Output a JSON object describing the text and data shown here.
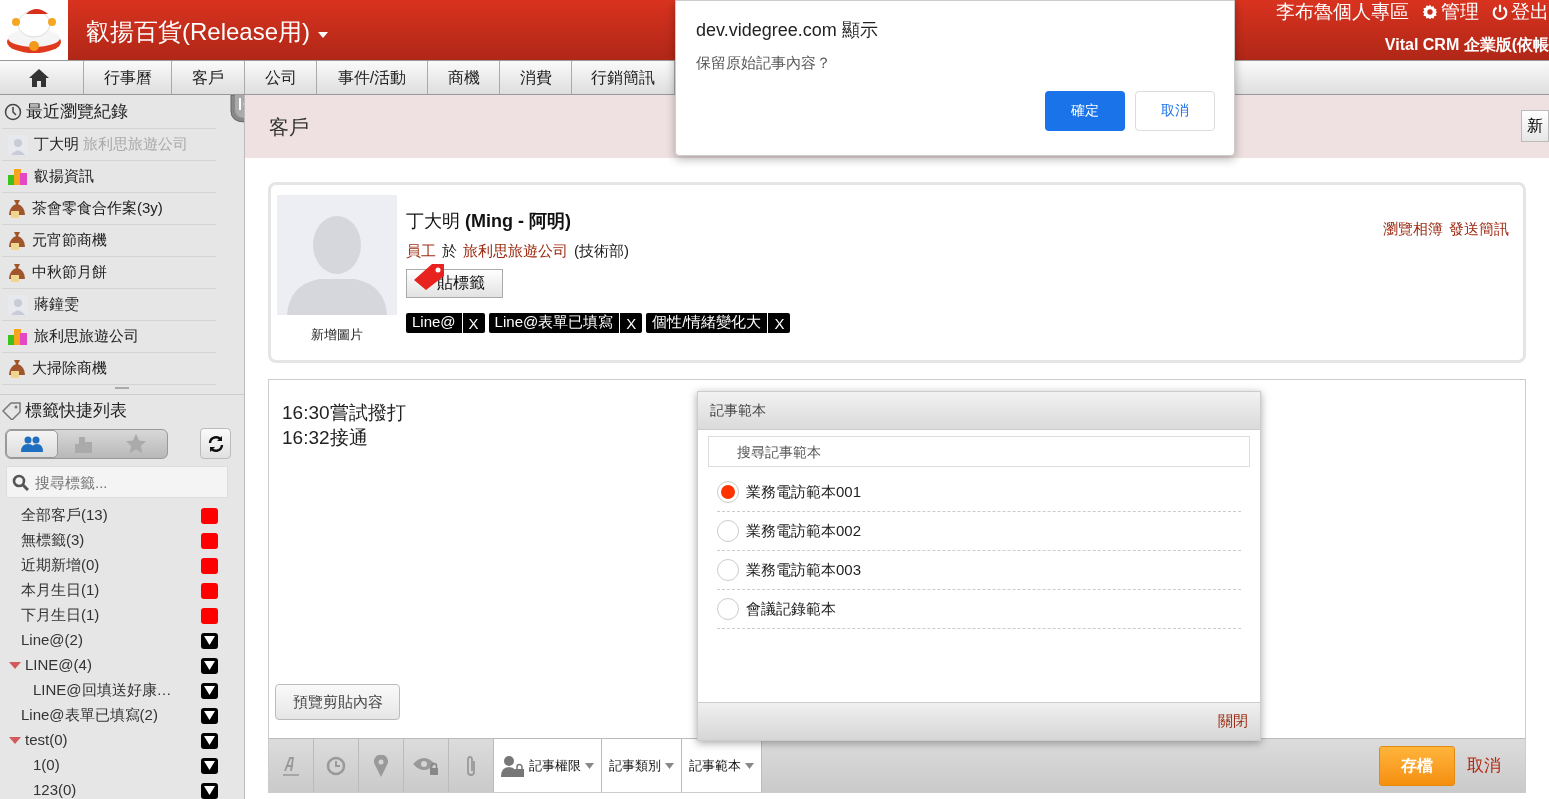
{
  "header": {
    "company": "叡揚百貨(Release用)",
    "user_links": [
      {
        "kind": "user",
        "label": "李布魯個人專區"
      },
      {
        "kind": "admin",
        "label": "管理"
      },
      {
        "kind": "logout",
        "label": "登出"
      }
    ],
    "edition": "Vital CRM 企業版(依帳"
  },
  "nav": {
    "tabs": [
      {
        "kind": "home"
      },
      {
        "kind": "text",
        "label": "行事曆"
      },
      {
        "kind": "text",
        "label": "客戶"
      },
      {
        "kind": "text",
        "label": "公司"
      },
      {
        "kind": "text",
        "label": "事件/活動"
      },
      {
        "kind": "text",
        "label": "商機"
      },
      {
        "kind": "text",
        "label": "消費"
      },
      {
        "kind": "text",
        "label": "行銷簡訊"
      }
    ]
  },
  "sidebar": {
    "recent_title": "最近瀏覽紀錄",
    "recent": [
      {
        "kind": "person",
        "name": "丁大明",
        "company": "旅利思旅遊公司"
      },
      {
        "kind": "company",
        "name": "叡揚資訊"
      },
      {
        "kind": "deal",
        "name": "茶會零食合作案(3y)"
      },
      {
        "kind": "deal",
        "name": "元宵節商機"
      },
      {
        "kind": "deal",
        "name": "中秋節月餅"
      },
      {
        "kind": "person",
        "name": "蔣鐘雯"
      },
      {
        "kind": "company",
        "name": "旅利思旅遊公司"
      },
      {
        "kind": "deal",
        "name": "大掃除商機"
      }
    ],
    "tags_title": "標籤快捷列表",
    "filters": [
      {
        "kind": "people",
        "selected": true
      },
      {
        "kind": "company",
        "selected": false
      },
      {
        "kind": "star",
        "selected": false
      }
    ],
    "tag_search": {
      "placeholder": "搜尋標籤..."
    },
    "tags": [
      {
        "kind": "system",
        "label": "全部客戶(13)"
      },
      {
        "kind": "system",
        "label": "無標籤(3)"
      },
      {
        "kind": "system",
        "label": "近期新增(0)"
      },
      {
        "kind": "system",
        "label": "本月生日(1)"
      },
      {
        "kind": "system",
        "label": "下月生日(1)"
      },
      {
        "kind": "tag",
        "label": "Line@(2)"
      },
      {
        "kind": "tag",
        "label": "LINE@(4)",
        "expanded": true,
        "children": [
          {
            "kind": "tag",
            "label": "LINE@回填送好康…"
          }
        ]
      },
      {
        "kind": "tag",
        "label": "Line@表單已填寫(2)"
      },
      {
        "kind": "tag",
        "label": "test(0)",
        "expanded": true,
        "children": [
          {
            "kind": "tag",
            "label": "1(0)"
          },
          {
            "kind": "tag",
            "label": "123(0)"
          }
        ]
      }
    ]
  },
  "page": {
    "title": "客戶",
    "new_button": "新"
  },
  "contact": {
    "photo_label": "新增圖片",
    "name": "丁大明 **(Ming - 阿明)**",
    "role": "員工",
    "conj": "於",
    "company": "旅利思旅遊公司",
    "dept": "(技術部)",
    "tag_button": "貼標籤",
    "tags": [
      {
        "label": "Line@",
        "remove": "X"
      },
      {
        "label": "Line@表單已填寫",
        "remove": "X"
      },
      {
        "label": "個性/情緒變化大",
        "remove": "X"
      }
    ],
    "links": [
      "瀏覽相簿",
      "發送簡訊"
    ]
  },
  "editor": {
    "lines": [
      "16:30嘗試撥打",
      "16:32接通"
    ],
    "preview_button": "預覽剪貼內容",
    "tools": [
      {
        "kind": "font"
      },
      {
        "kind": "clock"
      },
      {
        "kind": "pin"
      },
      {
        "kind": "eye-lock"
      },
      {
        "kind": "clip"
      }
    ],
    "menus": [
      {
        "kind": "permission",
        "label": "記事權限"
      },
      {
        "kind": "plain",
        "label": "記事類別"
      },
      {
        "kind": "plain",
        "label": "記事範本"
      }
    ],
    "save": "存檔",
    "cancel": "取消"
  },
  "template_popup": {
    "title": "記事範本",
    "search_placeholder": "搜尋記事範本",
    "options": [
      {
        "label": "業務電訪範本001",
        "selected": true
      },
      {
        "label": "業務電訪範本002",
        "selected": false
      },
      {
        "label": "業務電訪範本003",
        "selected": false
      },
      {
        "label": "會議記錄範本",
        "selected": false
      }
    ],
    "close": "關閉"
  },
  "dialog": {
    "origin": "dev.videgree.com 顯示",
    "message": "保留原始記事內容？",
    "ok": "確定",
    "cancel": "取消"
  }
}
